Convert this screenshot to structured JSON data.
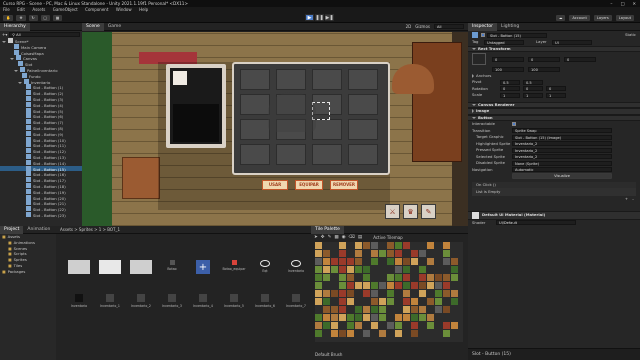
{
  "window": {
    "title": "Curso RPG - Scene - PC, Mac & Linux Standalone - Unity 2021.1.19f1 Personal* <DX11>"
  },
  "menu": [
    "File",
    "Edit",
    "Assets",
    "GameObject",
    "Component",
    "Window",
    "Help"
  ],
  "toolbar": {
    "account": "Account",
    "layers": "Layers",
    "layout": "Layout"
  },
  "hierarchy": {
    "tab": "Hierarchy",
    "search_placeholder": "All",
    "items": [
      {
        "label": "Scene*",
        "indent": 0,
        "expanded": true
      },
      {
        "label": "Main Camera",
        "indent": 2
      },
      {
        "label": "CoisasMapa",
        "indent": 2
      },
      {
        "label": "Canvas",
        "indent": 2,
        "expanded": true
      },
      {
        "label": "Slot",
        "indent": 3
      },
      {
        "label": "PainelInventario",
        "indent": 3,
        "expanded": true
      },
      {
        "label": "Fundo",
        "indent": 4
      },
      {
        "label": "Inventario",
        "indent": 4,
        "expanded": true
      },
      {
        "label": "Slot - Botton (1)",
        "indent": 5
      },
      {
        "label": "Slot - Botton (2)",
        "indent": 5
      },
      {
        "label": "Slot - Botton (3)",
        "indent": 5
      },
      {
        "label": "Slot - Botton (4)",
        "indent": 5
      },
      {
        "label": "Slot - Botton (5)",
        "indent": 5
      },
      {
        "label": "Slot - Botton (6)",
        "indent": 5
      },
      {
        "label": "Slot - Botton (7)",
        "indent": 5
      },
      {
        "label": "Slot - Botton (8)",
        "indent": 5
      },
      {
        "label": "Slot - Botton (9)",
        "indent": 5
      },
      {
        "label": "Slot - Botton (10)",
        "indent": 5
      },
      {
        "label": "Slot - Botton (11)",
        "indent": 5
      },
      {
        "label": "Slot - Botton (12)",
        "indent": 5
      },
      {
        "label": "Slot - Botton (13)",
        "indent": 5
      },
      {
        "label": "Slot - Botton (14)",
        "indent": 5
      },
      {
        "label": "Slot - Botton (15)",
        "indent": 5,
        "selected": true
      },
      {
        "label": "Slot - Botton (16)",
        "indent": 5
      },
      {
        "label": "Slot - Botton (17)",
        "indent": 5
      },
      {
        "label": "Slot - Botton (18)",
        "indent": 5
      },
      {
        "label": "Slot - Botton (19)",
        "indent": 5
      },
      {
        "label": "Slot - Botton (20)",
        "indent": 5
      },
      {
        "label": "Slot - Botton (21)",
        "indent": 5
      },
      {
        "label": "Slot - Botton (22)",
        "indent": 5
      },
      {
        "label": "Slot - Botton (23)",
        "indent": 5
      }
    ]
  },
  "scene": {
    "tabs": [
      "Scene",
      "Game"
    ],
    "active_tab": "Scene",
    "shading": "2D",
    "gizmos": "Gizmos",
    "search_placeholder": "All",
    "buttons": {
      "use": "USAR",
      "equip": "EQUIPAR",
      "remove": "REMOVER"
    }
  },
  "project": {
    "tabs": [
      "Project",
      "Animation"
    ],
    "items": [
      "Assets",
      "Animations",
      "Scenes",
      "Scripts",
      "Sprites",
      "Tiles",
      "Packages"
    ]
  },
  "animation": {
    "breadcrumb": "Assets > Sprites > 1 > BOT_1",
    "assets_row1": [
      "",
      "",
      "",
      "Botao",
      "",
      "Botao_equipar",
      "Eqt",
      "Inventario"
    ],
    "assets_row2": [
      "Inventario",
      "Inventario_1",
      "Inventario_2",
      "Inventario_3",
      "Inventario_4",
      "Inventario_5",
      "Inventario_6",
      "Inventario_7"
    ]
  },
  "tile_palette": {
    "tab": "Tile Palette",
    "active_tilemap": "Active Tilemap",
    "default_brush": "Default Brush"
  },
  "inspector": {
    "tabs": [
      "Inspector",
      "Lighting"
    ],
    "object_name": "Slot - Botton (15)",
    "static_label": "Static",
    "tag_label": "Tag",
    "tag_value": "Untagged",
    "layer_label": "Layer",
    "layer_value": "UI",
    "rect_transform": "Rect Transform",
    "pos": {
      "x": "0",
      "y": "0",
      "z": "0"
    },
    "width": "100",
    "height": "100",
    "anchors": "Anchors",
    "pivot": "Pivot",
    "rotation": "Rotation",
    "scale": "Scale",
    "scale_xyz": {
      "x": "1",
      "y": "1",
      "z": "1"
    },
    "canvas_renderer": "Canvas Renderer",
    "image": "Image",
    "button": "Button",
    "interactable": "Interactable",
    "transition": "Transition",
    "transition_value": "Sprite Swap",
    "target_graphic": "Target Graphic",
    "target_graphic_value": "Slot - Botton (15) (Image)",
    "highlighted_sprite": "Highlighted Sprite",
    "highlighted_value": "Inventario_2",
    "pressed_sprite": "Pressed Sprite",
    "pressed_value": "Inventario_2",
    "selected_sprite": "Selected Sprite",
    "selected_value": "Inventario_2",
    "disabled_sprite": "Disabled Sprite",
    "disabled_value": "None (Sprite)",
    "navigation": "Navigation",
    "navigation_value": "Automatic",
    "visualize": "Visualize",
    "on_click": "On Click ()",
    "list_empty": "List is Empty",
    "material": "Default UI Material (Material)",
    "shader_label": "Shader",
    "shader_value": "UI/Default",
    "footer": "Slot - Button (15)"
  },
  "colors": {
    "accent": "#2c5d87",
    "button_border": "#c1552a",
    "button_fill": "#f0d7b0",
    "grid_frame": "#d9d1c6"
  }
}
